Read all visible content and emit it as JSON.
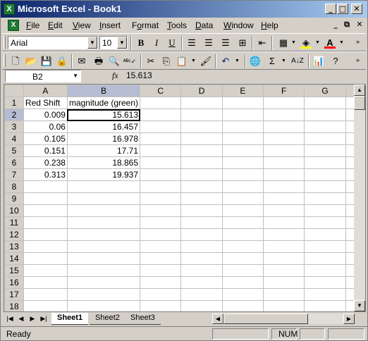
{
  "window": {
    "title": "Microsoft Excel - Book1",
    "app_icon": "X"
  },
  "menu": {
    "items": [
      {
        "label": "File",
        "key": "F"
      },
      {
        "label": "Edit",
        "key": "E"
      },
      {
        "label": "View",
        "key": "V"
      },
      {
        "label": "Insert",
        "key": "I"
      },
      {
        "label": "Format",
        "key": "o"
      },
      {
        "label": "Tools",
        "key": "T"
      },
      {
        "label": "Data",
        "key": "D"
      },
      {
        "label": "Window",
        "key": "W"
      },
      {
        "label": "Help",
        "key": "H"
      }
    ]
  },
  "formatting": {
    "font": "Arial",
    "size": "10",
    "bold_label": "B",
    "italic_label": "I",
    "underline_label": "U"
  },
  "formula_bar": {
    "name_box": "B2",
    "fx_label": "fx",
    "value": "15.613"
  },
  "sheet": {
    "columns": [
      "A",
      "B",
      "C",
      "D",
      "E",
      "F",
      "G"
    ],
    "active_cell": "B2",
    "rows": [
      [
        "Red Shift",
        "magnitude (green)",
        "",
        "",
        "",
        "",
        ""
      ],
      [
        "0.009",
        "15.613",
        "",
        "",
        "",
        "",
        ""
      ],
      [
        "0.06",
        "16.457",
        "",
        "",
        "",
        "",
        ""
      ],
      [
        "0.105",
        "16.978",
        "",
        "",
        "",
        "",
        ""
      ],
      [
        "0.151",
        "17.71",
        "",
        "",
        "",
        "",
        ""
      ],
      [
        "0.238",
        "18.865",
        "",
        "",
        "",
        "",
        ""
      ],
      [
        "0.313",
        "19.937",
        "",
        "",
        "",
        "",
        ""
      ],
      [
        "",
        "",
        "",
        "",
        "",
        "",
        ""
      ],
      [
        "",
        "",
        "",
        "",
        "",
        "",
        ""
      ],
      [
        "",
        "",
        "",
        "",
        "",
        "",
        ""
      ],
      [
        "",
        "",
        "",
        "",
        "",
        "",
        ""
      ],
      [
        "",
        "",
        "",
        "",
        "",
        "",
        ""
      ],
      [
        "",
        "",
        "",
        "",
        "",
        "",
        ""
      ],
      [
        "",
        "",
        "",
        "",
        "",
        "",
        ""
      ],
      [
        "",
        "",
        "",
        "",
        "",
        "",
        ""
      ],
      [
        "",
        "",
        "",
        "",
        "",
        "",
        ""
      ],
      [
        "",
        "",
        "",
        "",
        "",
        "",
        ""
      ],
      [
        "",
        "",
        "",
        "",
        "",
        "",
        ""
      ]
    ],
    "tabs": [
      "Sheet1",
      "Sheet2",
      "Sheet3"
    ],
    "active_tab": "Sheet1"
  },
  "status": {
    "left": "Ready",
    "num": "NUM"
  }
}
